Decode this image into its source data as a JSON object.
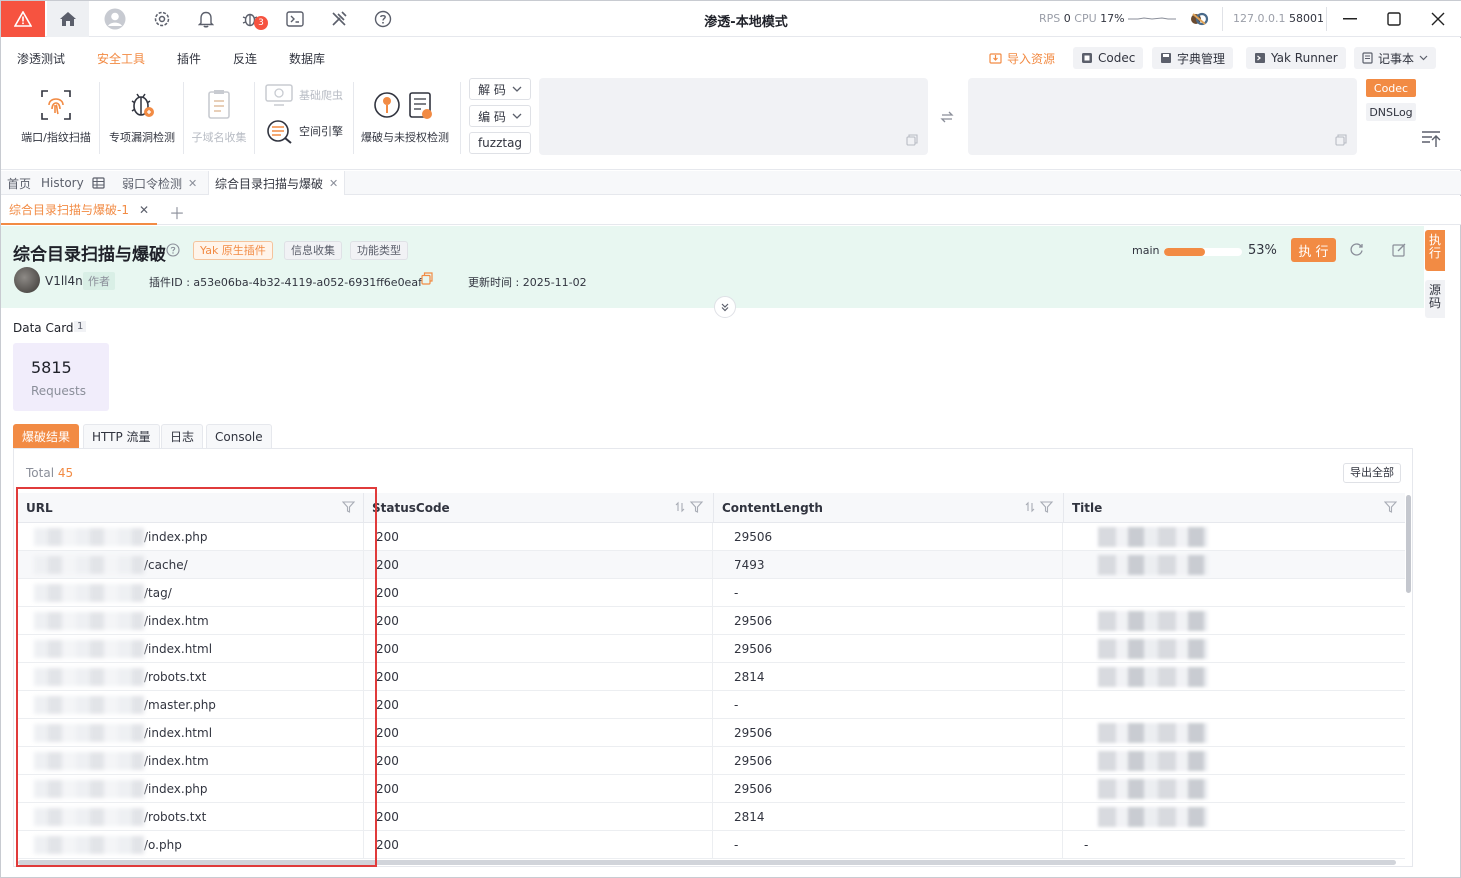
{
  "titlebar": {
    "title": "渗透-本地模式",
    "rps_label": "RPS",
    "rps_value": "0",
    "cpu_label": "CPU",
    "cpu_value": "17%",
    "ip": "127.0.0.1",
    "port": "58001",
    "bug_badge": "3"
  },
  "menu": {
    "tabs": [
      "渗透测试",
      "安全工具",
      "插件",
      "反连",
      "数据库"
    ],
    "active_tab": 1,
    "tools": {
      "port_scan": "端口/指纹扫描",
      "vuln_detect": "专项漏洞检测",
      "subdomain": "子域名收集",
      "crawler": "基础爬虫",
      "space_engine": "空间引擎",
      "brute": "爆破与未授权检测"
    },
    "decode": "解 码",
    "encode": "编 码",
    "fuzztag": "fuzztag",
    "import": "导入资源",
    "codec": "Codec",
    "dict": "字典管理",
    "runner": "Yak Runner",
    "notebook": "记事本",
    "side_codec": "Codec",
    "side_dnslog": "DNSLog"
  },
  "tabs1": {
    "home": "首页",
    "history": "History",
    "weak": "弱口令检测",
    "current": "综合目录扫描与爆破"
  },
  "tabs2": {
    "current": "综合目录扫描与爆破-1"
  },
  "plugin": {
    "title": "综合目录扫描与爆破",
    "tag_yak": "Yak 原生插件",
    "tag_info": "信息收集",
    "tag_func": "功能类型",
    "author": "V1ll4n",
    "author_tag": "作者",
    "id_label": "插件ID : a53e06ba-4b32-4119-a052-6931ff6e0eaf",
    "updated": "更新时间 : 2025-11-02",
    "branch": "main",
    "progress": 0.53,
    "progress_text": "53%",
    "run": "执 行"
  },
  "side_tabs": {
    "exec": "执行",
    "source": "源码"
  },
  "data_card": {
    "title": "Data Card",
    "count": "1",
    "value": "5815",
    "label": "Requests"
  },
  "result_tabs": [
    "爆破结果",
    "HTTP 流量",
    "日志",
    "Console"
  ],
  "table": {
    "total_label": "Total",
    "total": "45",
    "export": "导出全部",
    "columns": [
      "URL",
      "StatusCode",
      "ContentLength",
      "Title"
    ],
    "rows": [
      {
        "url": "/index.php",
        "status": "200",
        "length": "29506",
        "title": ""
      },
      {
        "url": "/cache/",
        "status": "200",
        "length": "7493",
        "title": ""
      },
      {
        "url": "/tag/",
        "status": "200",
        "length": "-",
        "title": ""
      },
      {
        "url": "/index.htm",
        "status": "200",
        "length": "29506",
        "title": ""
      },
      {
        "url": "/index.html",
        "status": "200",
        "length": "29506",
        "title": ""
      },
      {
        "url": "/robots.txt",
        "status": "200",
        "length": "2814",
        "title": ""
      },
      {
        "url": "/master.php",
        "status": "200",
        "length": "-",
        "title": ""
      },
      {
        "url": "/index.html",
        "status": "200",
        "length": "29506",
        "title": ""
      },
      {
        "url": "/index.htm",
        "status": "200",
        "length": "29506",
        "title": ""
      },
      {
        "url": "/index.php",
        "status": "200",
        "length": "29506",
        "title": ""
      },
      {
        "url": "/robots.txt",
        "status": "200",
        "length": "2814",
        "title": ""
      },
      {
        "url": "/o.php",
        "status": "200",
        "length": "-",
        "title": "-"
      }
    ]
  },
  "colors": {
    "accent": "#f28b44",
    "warn": "#f65340",
    "highlight": "#e03b3b",
    "header_bg": "#e8f7f1"
  }
}
